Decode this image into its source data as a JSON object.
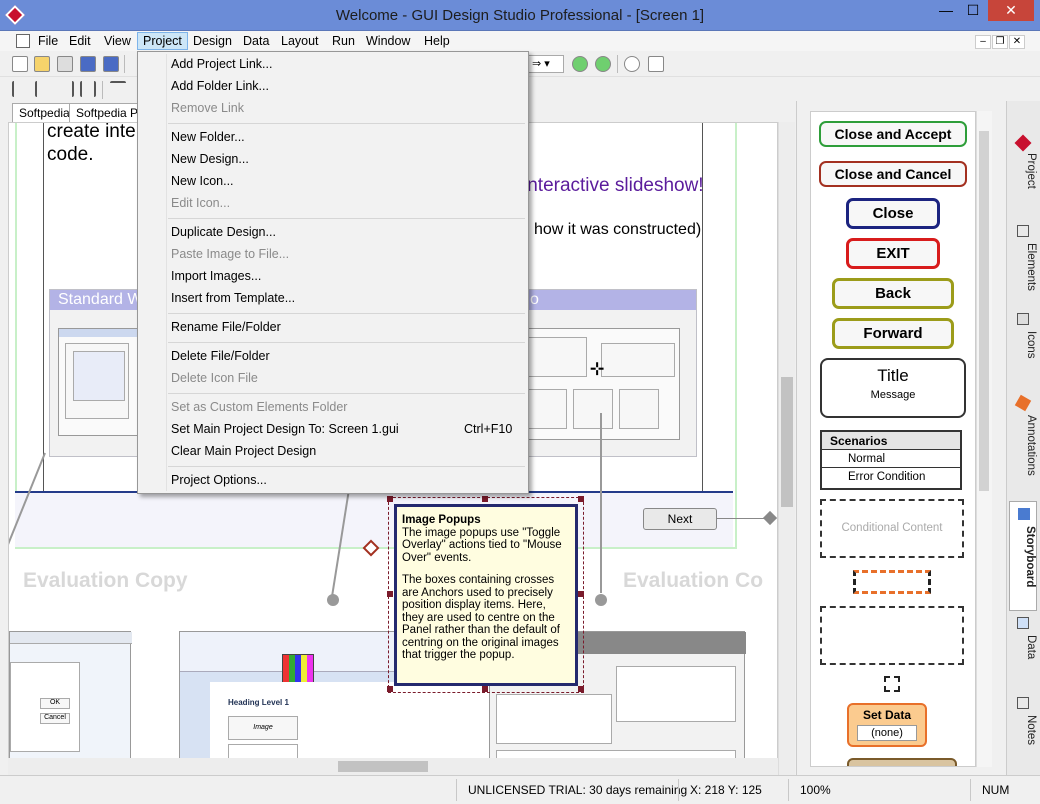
{
  "window": {
    "title": "Welcome - GUI Design Studio Professional - [Screen 1]",
    "min": "—",
    "max": "☐",
    "close": "✕"
  },
  "menubar": [
    "File",
    "Edit",
    "View",
    "Project",
    "Design",
    "Data",
    "Layout",
    "Run",
    "Window",
    "Help"
  ],
  "mdi_buttons": [
    "–",
    "❐",
    "✕"
  ],
  "tabs": [
    "Softpedia",
    "Softpedia Pro"
  ],
  "project_menu": {
    "items": [
      {
        "label": "Add Project Link...",
        "enabled": true
      },
      {
        "label": "Add Folder Link...",
        "enabled": true
      },
      {
        "label": "Remove Link",
        "enabled": false
      },
      {
        "label": "New Folder...",
        "enabled": true
      },
      {
        "label": "New Design...",
        "enabled": true
      },
      {
        "label": "New Icon...",
        "enabled": true
      },
      {
        "label": "Edit Icon...",
        "enabled": false
      },
      {
        "label": "Duplicate Design...",
        "enabled": true
      },
      {
        "label": "Paste Image to File...",
        "enabled": false
      },
      {
        "label": "Import Images...",
        "enabled": true
      },
      {
        "label": "Insert from Template...",
        "enabled": true
      },
      {
        "label": "Rename File/Folder",
        "enabled": true
      },
      {
        "label": "Delete File/Folder",
        "enabled": true
      },
      {
        "label": "Delete Icon File",
        "enabled": false
      },
      {
        "label": "Set as Custom Elements Folder",
        "enabled": false
      },
      {
        "label": "Set Main Project Design To: Screen 1.gui",
        "enabled": true,
        "shortcut": "Ctrl+F10"
      },
      {
        "label": "Clear Main Project Design",
        "enabled": true
      },
      {
        "label": "Project Options...",
        "enabled": true
      }
    ]
  },
  "canvas": {
    "line1": "create inte",
    "line2": "code.",
    "slideshow": "interactive slideshow!",
    "constructed": "how it was constructed)",
    "panel_left_title": "Standard W",
    "panel_right_title": "o",
    "next_button": "Next",
    "eval_left": "Evaluation Copy",
    "eval_right": "Evaluation Co",
    "heading_level": "Heading Level 1",
    "image_label": "Image"
  },
  "popup": {
    "title": "Image Popups",
    "p1": "The image popups use \"Toggle Overlay\" actions tied to \"Mouse Over\" events.",
    "p2": "The boxes containing crosses are Anchors used to precisely position display items. Here, they are used to centre on the Panel rather than the default of centring on the original images that trigger the popup."
  },
  "elements": {
    "close_accept": "Close and Accept",
    "close_cancel": "Close and Cancel",
    "close": "Close",
    "exit": "EXIT",
    "back": "Back",
    "forward": "Forward",
    "title": "Title",
    "message": "Message",
    "scenarios": "Scenarios",
    "normal": "Normal",
    "error": "Error Condition",
    "conditional": "Conditional Content",
    "set_data": "Set Data",
    "none": "(none)"
  },
  "sidetabs": [
    "Project",
    "Elements",
    "Icons",
    "Annotations",
    "Storyboard",
    "Data",
    "Notes"
  ],
  "status": {
    "license": "UNLICENSED TRIAL: 30 days remaining",
    "coords": "X: 218  Y: 125",
    "zoom": "100%",
    "num": "NUM"
  },
  "colors": {
    "accept": "#2e9e3a",
    "cancel": "#a33020",
    "close": "#1c2480",
    "exit": "#d81c1c",
    "nav": "#9c9c1a",
    "title_bar": "#6b8cd7",
    "set_data": "#f59a3c"
  }
}
